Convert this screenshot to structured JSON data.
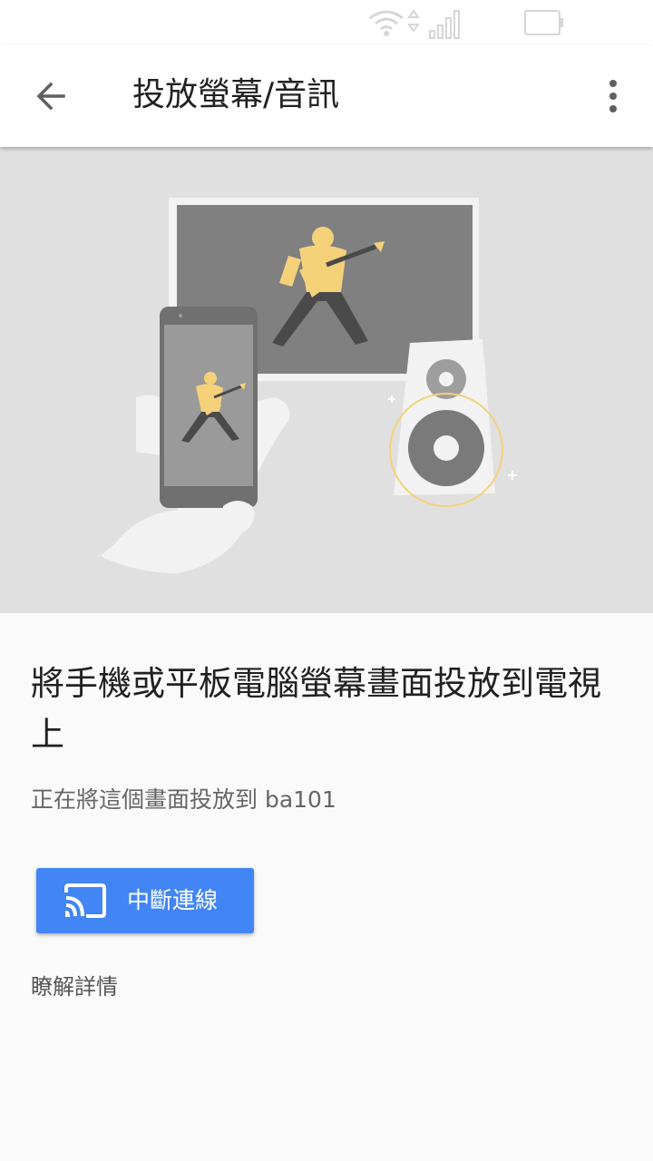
{
  "app_bar": {
    "title": "投放螢幕/音訊"
  },
  "main": {
    "headline": "將手機或平板電腦螢幕畫面投放到電視上",
    "status_text": "正在將這個畫面投放到 ba101",
    "disconnect_label": "中斷連線",
    "learn_more_label": "瞭解詳情"
  },
  "icons": {
    "status": [
      "wifi-icon",
      "cellular-signal-icon",
      "battery-icon"
    ],
    "app_bar": [
      "back-arrow-icon",
      "more-vert-icon"
    ],
    "button": "cast-icon"
  },
  "colors": {
    "primary": "#4285f4",
    "hero_background": "#e0e0e0",
    "accent_yellow": "#f5d27a"
  }
}
